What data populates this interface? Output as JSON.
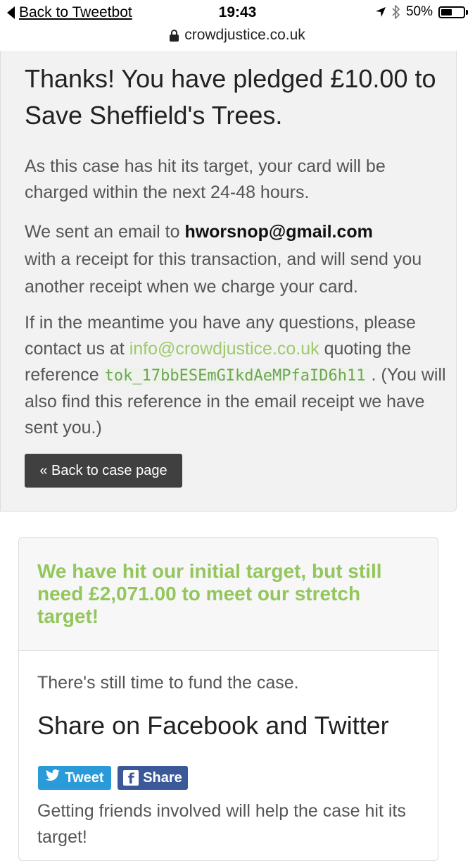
{
  "status_bar": {
    "back_app": "Back to Tweetbot",
    "time": "19:43",
    "battery": "50%",
    "battery_level": 0.5
  },
  "browser": {
    "url": "crowdjustice.co.uk"
  },
  "confirmation": {
    "title": "Thanks! You have pledged £10.00 to Save Sheffield's Trees.",
    "charge_note": "As this case has hit its target, your card will be charged within the next 24-48 hours.",
    "email_prefix": "We sent an email to",
    "email": "hworsnop@gmail.com",
    "email_suffix": "with a receipt for this transaction, and will send you another receipt when we charge your card.",
    "questions_prefix": "If in the meantime you have any questions, please contact us at",
    "contact_email": "info@crowdjustice.co.uk",
    "questions_mid": "quoting the reference",
    "reference": "tok_17bbESEmGIkdAeMPfaID6h11",
    "questions_suffix": ". (You will also find this reference in the email receipt we have sent you.)",
    "back_button": "« Back to case page"
  },
  "target_card": {
    "headline": "We have hit our initial target, but still need £2,071.00 to meet our stretch target!",
    "still_time": "There's still time to fund the case.",
    "share_heading": "Share on Facebook and Twitter",
    "tweet_label": "Tweet",
    "share_label": "Share",
    "friends_text": "Getting friends involved will help the case hit its target!"
  },
  "colors": {
    "accent_green": "#93c65c",
    "link_green": "#9dca6a",
    "twitter_blue": "#2a9bd8",
    "facebook_blue": "#3b5998",
    "button_dark": "#404040"
  }
}
